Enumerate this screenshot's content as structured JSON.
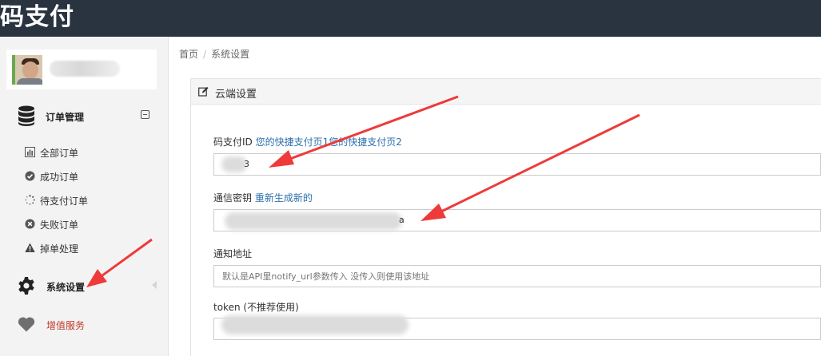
{
  "app": {
    "title": "码支付"
  },
  "sidebar": {
    "group": {
      "label": "订单管理",
      "icon": "database-icon"
    },
    "sub_items": [
      {
        "label": "全部订单",
        "icon": "bar-chart-icon"
      },
      {
        "label": "成功订单",
        "icon": "check-circle-icon"
      },
      {
        "label": "待支付订单",
        "icon": "spinner-icon"
      },
      {
        "label": "失败订单",
        "icon": "x-circle-icon"
      },
      {
        "label": "掉单处理",
        "icon": "warning-icon"
      }
    ],
    "settings": {
      "label": "系统设置",
      "icon": "gear-icon"
    },
    "value_added": {
      "label": "增值服务",
      "icon": "heart-icon",
      "color": "#c0392b"
    }
  },
  "breadcrumb": {
    "home": "首页",
    "separator": "/",
    "current": "系统设置"
  },
  "panel": {
    "title": "云端设置",
    "fields": {
      "codepay_id": {
        "label": "码支付ID",
        "links": [
          "您的快捷支付页1",
          "您的快捷支付页2"
        ],
        "value_tail": "3"
      },
      "secret_key": {
        "label": "通信密钥",
        "link": "重新生成新的",
        "value_tail": "a"
      },
      "notify_url": {
        "label": "通知地址",
        "placeholder": "默认是API里notify_url参数传入 没传入则使用该地址"
      },
      "token": {
        "label": "token",
        "note": "(不推荐使用)"
      }
    }
  },
  "colors": {
    "topbar": "#2a3440",
    "link": "#2b6fad",
    "arrow": "#ee3a3a"
  }
}
